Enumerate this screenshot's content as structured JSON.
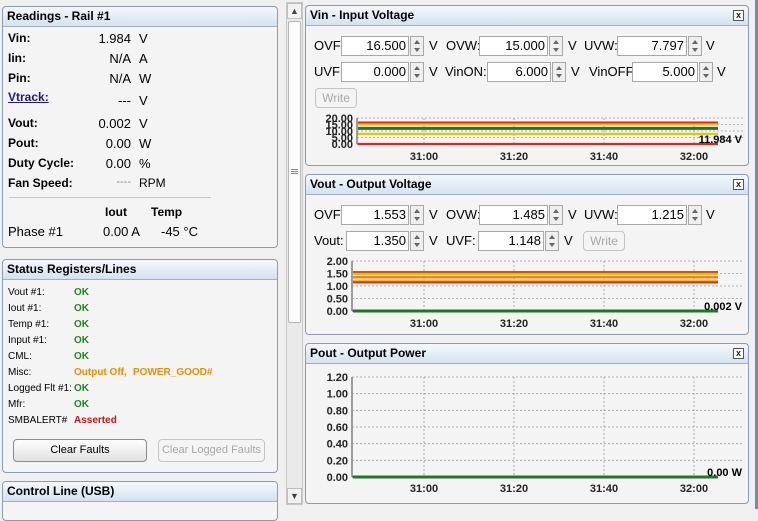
{
  "readings": {
    "title": "Readings - Rail #1",
    "rows": [
      {
        "label": "Vin:",
        "value": "1.984",
        "unit": "V"
      },
      {
        "label": "Iin:",
        "value": "N/A",
        "unit": "A"
      },
      {
        "label": "Pin:",
        "value": "N/A",
        "unit": "W"
      },
      {
        "label": "Vtrack:",
        "value": "---",
        "unit": "V"
      },
      {
        "label": "Vout:",
        "value": "0.002",
        "unit": "V"
      },
      {
        "label": "Pout:",
        "value": "0.00",
        "unit": "W"
      },
      {
        "label": "Duty Cycle:",
        "value": "0.00",
        "unit": "%"
      },
      {
        "label": "Fan Speed:",
        "value": "----",
        "unit": "RPM"
      }
    ],
    "phase_header": {
      "iout": "Iout",
      "temp": "Temp"
    },
    "phase_row": {
      "label": "Phase #1",
      "iout": "0.00 A",
      "temp": "-45 °C"
    }
  },
  "status": {
    "title": "Status Registers/Lines",
    "rows": [
      {
        "label": "Vout #1:",
        "value": "OK"
      },
      {
        "label": "Iout #1:",
        "value": "OK"
      },
      {
        "label": "Temp #1:",
        "value": "OK"
      },
      {
        "label": "Input #1:",
        "value": "OK"
      },
      {
        "label": "CML:",
        "value": "OK"
      },
      {
        "label": "Misc:",
        "value": "Output Off,",
        "value2": "POWER_GOOD#"
      },
      {
        "label": "Logged Flt #1:",
        "value": "OK"
      },
      {
        "label": "Mfr:",
        "value": "OK"
      },
      {
        "label": "SMBALERT#",
        "value": "Asserted"
      }
    ],
    "clear_faults": "Clear Faults",
    "clear_logged_faults": "Clear Logged Faults"
  },
  "control": {
    "title": "Control Line (USB)"
  },
  "vin_panel": {
    "title": "Vin - Input Voltage",
    "close": "x",
    "fields": [
      {
        "label": "OVF:",
        "value": "16.500",
        "unit": "V"
      },
      {
        "label": "OVW:",
        "value": "15.000",
        "unit": "V"
      },
      {
        "label": "UVW:",
        "value": "7.797",
        "unit": "V"
      },
      {
        "label": "UVF:",
        "value": "0.000",
        "unit": "V"
      },
      {
        "label": "VinON:",
        "value": "6.000",
        "unit": "V"
      },
      {
        "label": "VinOFF:",
        "value": "5.000",
        "unit": "V"
      }
    ],
    "write": "Write"
  },
  "vout_panel": {
    "title": "Vout - Output Voltage",
    "close": "x",
    "fields": [
      {
        "label": "OVF:",
        "value": "1.553",
        "unit": "V"
      },
      {
        "label": "OVW:",
        "value": "1.485",
        "unit": "V"
      },
      {
        "label": "UVW:",
        "value": "1.215",
        "unit": "V"
      },
      {
        "label": "Vout:",
        "value": "1.350",
        "unit": "V"
      },
      {
        "label": "UVF:",
        "value": "1.148",
        "unit": "V"
      }
    ],
    "write": "Write"
  },
  "pout_panel": {
    "title": "Pout - Output Power",
    "close": "x"
  },
  "colors": {
    "fault": "#e8251a",
    "warning": "#f2c200",
    "nominal": "#f07818",
    "trace": "#1e7a1e",
    "ok": "#1f8a1f",
    "orange": "#f08c00",
    "asserted": "#d01010"
  },
  "chart_data": [
    {
      "type": "line",
      "name": "vin",
      "x_ticks": [
        "31:00",
        "31:20",
        "31:40",
        "32:00"
      ],
      "y_ticks": [
        "0.00",
        "5.00",
        "10.00",
        "15.00",
        "20.00"
      ],
      "ylim": [
        0,
        20
      ],
      "thresholds": [
        {
          "kind": "fault",
          "value": 16.5
        },
        {
          "kind": "warning",
          "value": 15.0
        },
        {
          "kind": "nominal",
          "value": 12.0
        },
        {
          "kind": "warning",
          "value": 7.797
        },
        {
          "kind": "fault",
          "value": 0.0
        }
      ],
      "series": [
        {
          "values": [
            11.984,
            11.984,
            11.984,
            11.984,
            11.984,
            11.984,
            11.984,
            11.984
          ]
        }
      ],
      "latest_label": "11.984 V",
      "grid": true
    },
    {
      "type": "line",
      "name": "vout",
      "x_ticks": [
        "31:00",
        "31:20",
        "31:40",
        "32:00"
      ],
      "y_ticks": [
        "0.00",
        "0.50",
        "1.00",
        "1.50",
        "2.00"
      ],
      "ylim": [
        0,
        2
      ],
      "thresholds": [
        {
          "kind": "fault",
          "value": 1.553
        },
        {
          "kind": "warning",
          "value": 1.485
        },
        {
          "kind": "nominal",
          "value": 1.35
        },
        {
          "kind": "warning",
          "value": 1.215
        },
        {
          "kind": "fault",
          "value": 1.148
        }
      ],
      "series": [
        {
          "values": [
            0.002,
            0.002,
            0.002,
            0.002,
            0.002,
            0.002,
            0.002,
            0.002
          ]
        }
      ],
      "latest_label": "0.002 V",
      "grid": true
    },
    {
      "type": "line",
      "name": "pout",
      "x_ticks": [
        "31:00",
        "31:20",
        "31:40",
        "32:00"
      ],
      "y_ticks": [
        "0.00",
        "0.20",
        "0.40",
        "0.60",
        "0.80",
        "1.00",
        "1.20"
      ],
      "ylim": [
        0,
        1.2
      ],
      "thresholds": [],
      "series": [
        {
          "values": [
            0,
            0,
            0,
            0,
            0,
            0,
            0,
            0
          ]
        }
      ],
      "latest_label": "0.00 W",
      "grid": true
    }
  ]
}
